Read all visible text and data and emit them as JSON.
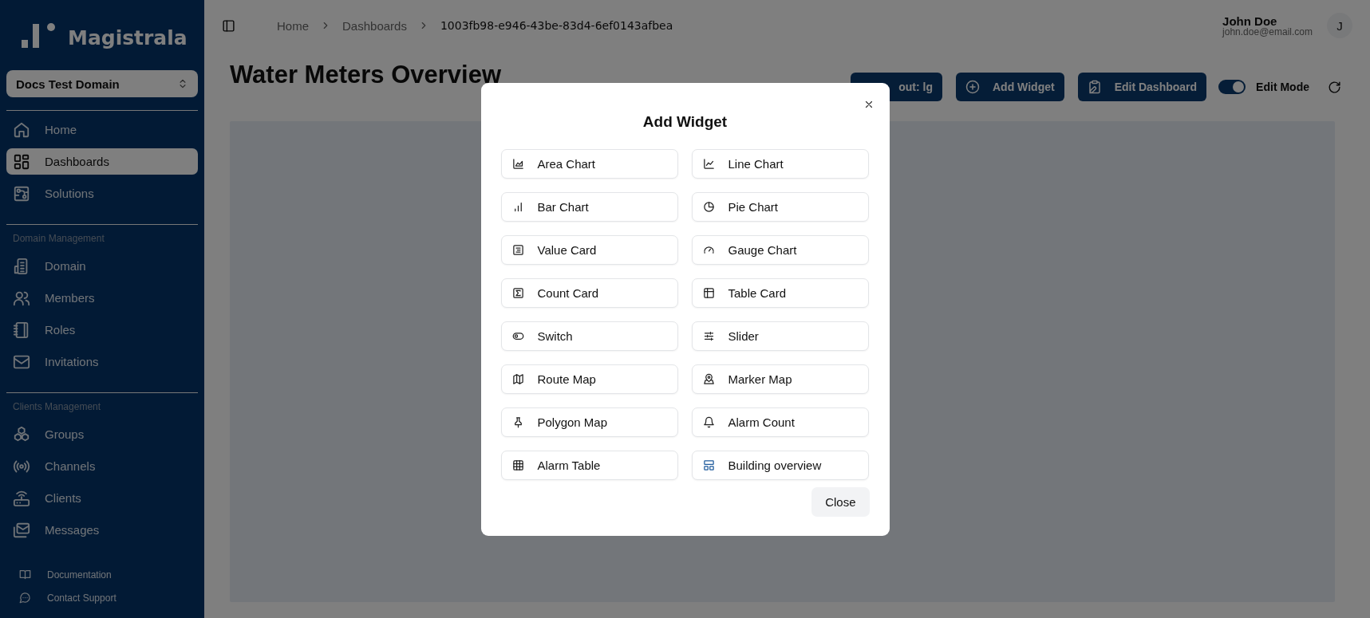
{
  "sidebar": {
    "brand": "Magistrala",
    "domain_select": {
      "value": "Docs Test Domain"
    },
    "sections": [
      {
        "items": [
          {
            "label": "Home",
            "selected": false
          },
          {
            "label": "Dashboards",
            "selected": true
          },
          {
            "label": "Solutions",
            "selected": false
          }
        ]
      },
      {
        "title": "Domain Management",
        "items": [
          {
            "label": "Domain",
            "selected": false
          },
          {
            "label": "Members",
            "selected": false
          },
          {
            "label": "Roles",
            "selected": false
          },
          {
            "label": "Invitations",
            "selected": false
          }
        ]
      },
      {
        "title": "Clients Management",
        "items": [
          {
            "label": "Groups",
            "selected": false
          },
          {
            "label": "Channels",
            "selected": false
          },
          {
            "label": "Clients",
            "selected": false
          },
          {
            "label": "Messages",
            "selected": false
          }
        ]
      }
    ],
    "footer_links": [
      "Documentation",
      "Contact Support"
    ]
  },
  "breadcrumb": [
    "Home",
    "Dashboards",
    "1003fb98-e946-43be-83d4-6ef0143afbea"
  ],
  "user": {
    "name": "John Doe",
    "email": "john.doe@email.com",
    "avatar": "J"
  },
  "page_title": "Water Meters Overview",
  "toolbar": {
    "buttons": [
      "out: lg",
      "Add Widget",
      "Edit Dashboard"
    ],
    "edit_mode": {
      "label": "Edit Mode",
      "on": true
    }
  },
  "dialog": {
    "title": "Add Widget",
    "close_button": "Close",
    "widgets": [
      "Area Chart",
      "Line Chart",
      "Bar Chart",
      "Pie Chart",
      "Value Card",
      "Gauge Chart",
      "Count Card",
      "Table Card",
      "Switch",
      "Slider",
      "Route Map",
      "Marker Map",
      "Polygon Map",
      "Alarm Count",
      "Alarm Table",
      "Building overview"
    ]
  }
}
